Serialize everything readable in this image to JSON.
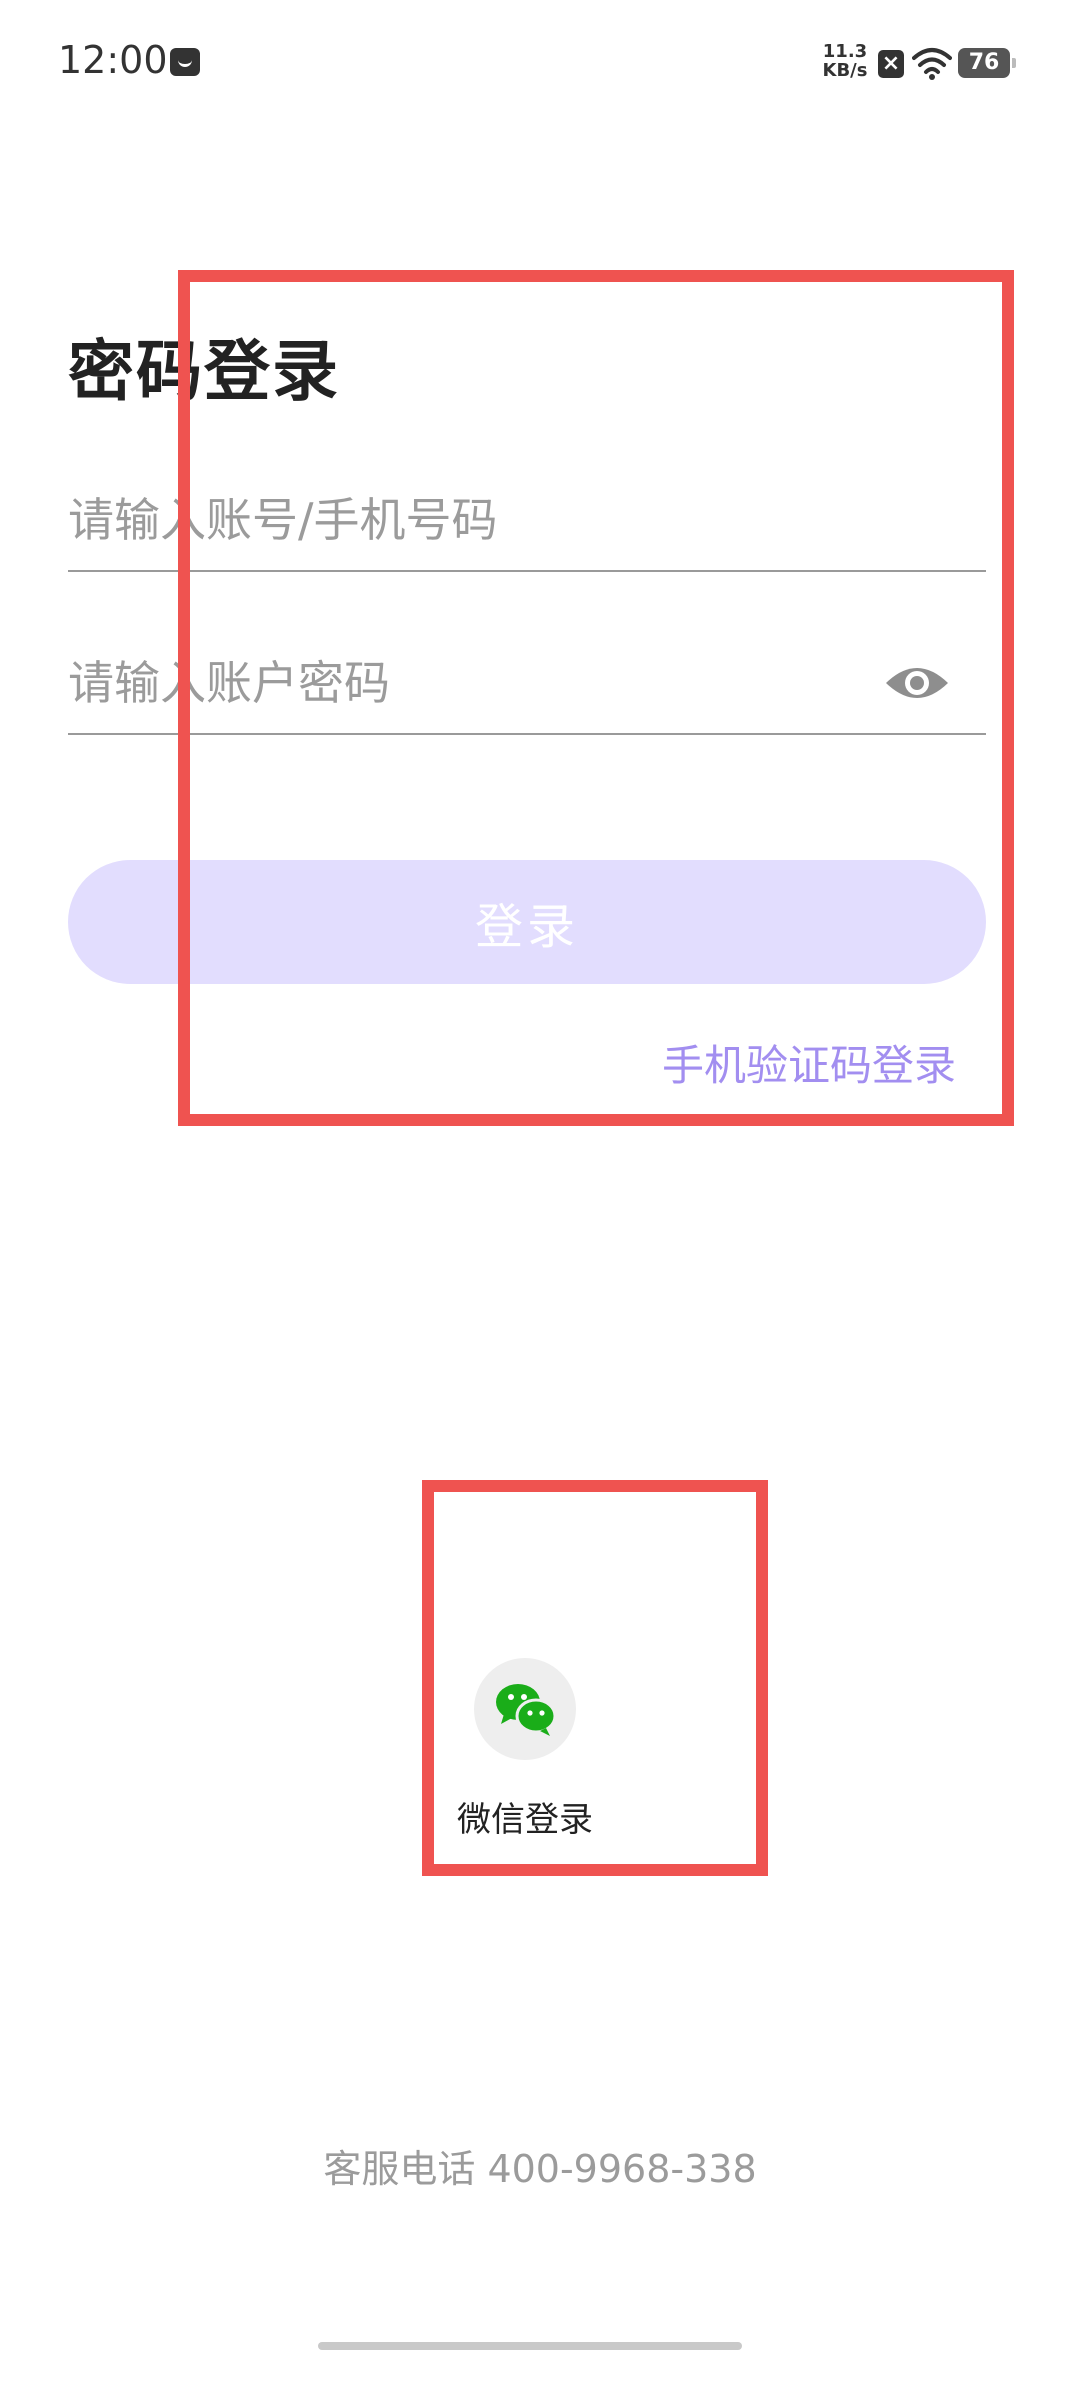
{
  "status_bar": {
    "time": "12:00",
    "network_speed_value": "11.3",
    "network_speed_unit": "KB/s",
    "battery": "76",
    "icons": [
      "message-icon",
      "no-sim-icon",
      "wifi-icon",
      "battery-icon"
    ]
  },
  "page": {
    "title": "密码登录"
  },
  "form": {
    "account_placeholder": "请输入账号/手机号码",
    "password_placeholder": "请输入账户密码",
    "login_label": "登录",
    "sms_login_label": "手机验证码登录"
  },
  "third_party": {
    "wechat_label": "微信登录",
    "wechat_icon": "wechat-icon"
  },
  "footer": {
    "service_phone": "客服电话 400-9968-338"
  },
  "colors": {
    "login_button_bg": "#e2ddfe",
    "link": "#a28ef0",
    "annotation": "#ef5350",
    "wechat_green": "#1aad19"
  }
}
